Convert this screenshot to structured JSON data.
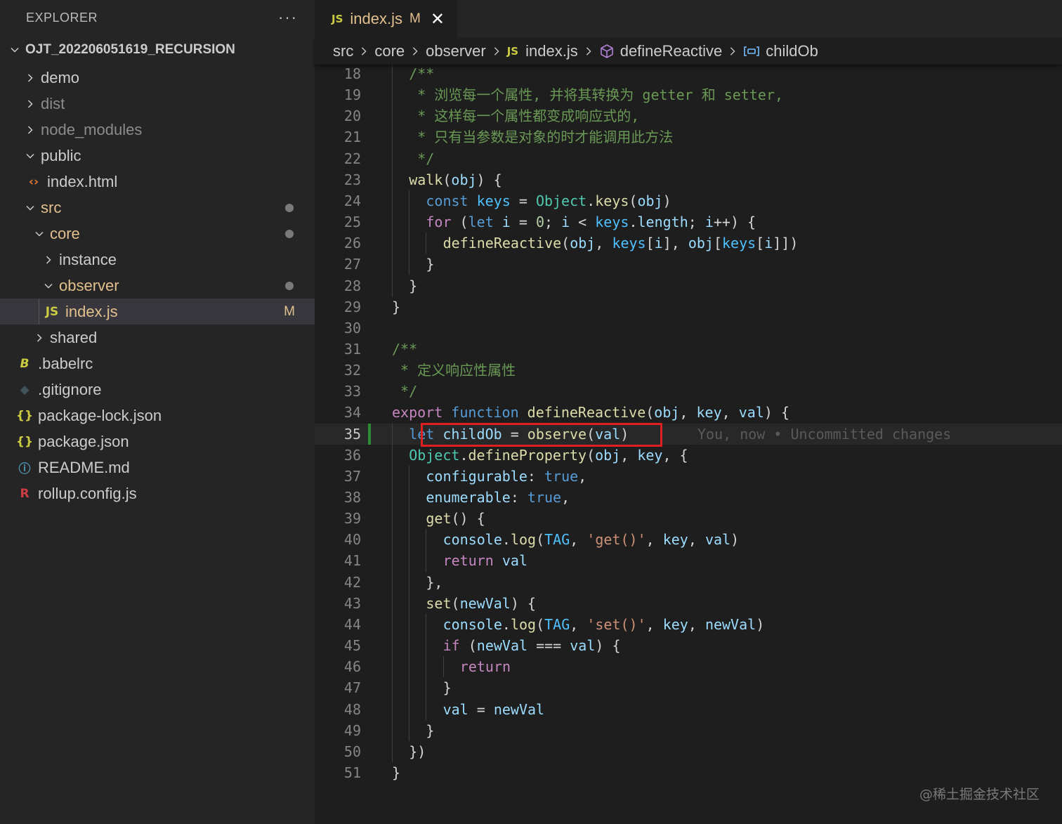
{
  "sidebar": {
    "title": "EXPLORER",
    "more": "···",
    "root": "OJT_202206051619_RECURSION",
    "items": [
      {
        "label": "demo",
        "depth": 1,
        "kind": "folder",
        "open": false
      },
      {
        "label": "dist",
        "depth": 1,
        "kind": "folder",
        "open": false,
        "dim": true
      },
      {
        "label": "node_modules",
        "depth": 1,
        "kind": "folder",
        "open": false,
        "dim": true
      },
      {
        "label": "public",
        "depth": 1,
        "kind": "folder",
        "open": true
      },
      {
        "label": "index.html",
        "depth": 2,
        "kind": "html"
      },
      {
        "label": "src",
        "depth": 1,
        "kind": "folder",
        "open": true,
        "modified": true,
        "dot": true
      },
      {
        "label": "core",
        "depth": 2,
        "kind": "folder",
        "open": true,
        "modified": true,
        "dot": true
      },
      {
        "label": "instance",
        "depth": 3,
        "kind": "folder",
        "open": false
      },
      {
        "label": "observer",
        "depth": 3,
        "kind": "folder",
        "open": true,
        "modified": true,
        "dot": true
      },
      {
        "label": "index.js",
        "depth": 4,
        "kind": "js",
        "modified": true,
        "badge": "M",
        "selected": true
      },
      {
        "label": "shared",
        "depth": 2,
        "kind": "folder",
        "open": false
      },
      {
        "label": ".babelrc",
        "depth": 1,
        "kind": "babel"
      },
      {
        "label": ".gitignore",
        "depth": 1,
        "kind": "git"
      },
      {
        "label": "package-lock.json",
        "depth": 1,
        "kind": "json"
      },
      {
        "label": "package.json",
        "depth": 1,
        "kind": "json"
      },
      {
        "label": "README.md",
        "depth": 1,
        "kind": "info"
      },
      {
        "label": "rollup.config.js",
        "depth": 1,
        "kind": "rollup"
      }
    ]
  },
  "tab": {
    "icon_text": "JS",
    "name": "index.js",
    "status": "M",
    "close": "✕"
  },
  "breadcrumbs": {
    "items": [
      "src",
      "core",
      "observer",
      "index.js",
      "defineReactive",
      "childOb"
    ],
    "js_icon": "JS"
  },
  "editor": {
    "current_line": 35,
    "lines": [
      {
        "n": "18",
        "indent": 2,
        "tokens": [
          [
            "cmt",
            "/**"
          ]
        ]
      },
      {
        "n": "19",
        "indent": 2,
        "tokens": [
          [
            "cmt",
            " * 浏览每一个属性, 并将其转换为 getter 和 setter,"
          ]
        ]
      },
      {
        "n": "20",
        "indent": 2,
        "tokens": [
          [
            "cmt",
            " * 这样每一个属性都变成响应式的,"
          ]
        ]
      },
      {
        "n": "21",
        "indent": 2,
        "tokens": [
          [
            "cmt",
            " * 只有当参数是对象的时才能调用此方法"
          ]
        ]
      },
      {
        "n": "22",
        "indent": 2,
        "tokens": [
          [
            "cmt",
            " */"
          ]
        ]
      },
      {
        "n": "23",
        "indent": 2,
        "tokens": [
          [
            "fn",
            "walk"
          ],
          [
            "pl",
            "("
          ],
          [
            "var",
            "obj"
          ],
          [
            "pl",
            ") {"
          ]
        ]
      },
      {
        "n": "24",
        "indent": 4,
        "tokens": [
          [
            "kw",
            "const "
          ],
          [
            "cst",
            "keys"
          ],
          [
            "pl",
            " = "
          ],
          [
            "cls",
            "Object"
          ],
          [
            "pl",
            "."
          ],
          [
            "fn",
            "keys"
          ],
          [
            "pl",
            "("
          ],
          [
            "var",
            "obj"
          ],
          [
            "pl",
            ")"
          ]
        ]
      },
      {
        "n": "25",
        "indent": 4,
        "tokens": [
          [
            "ctl",
            "for"
          ],
          [
            "pl",
            " ("
          ],
          [
            "kw",
            "let "
          ],
          [
            "var",
            "i"
          ],
          [
            "pl",
            " = "
          ],
          [
            "num",
            "0"
          ],
          [
            "pl",
            "; "
          ],
          [
            "var",
            "i"
          ],
          [
            "pl",
            " < "
          ],
          [
            "cst",
            "keys"
          ],
          [
            "pl",
            "."
          ],
          [
            "var",
            "length"
          ],
          [
            "pl",
            "; "
          ],
          [
            "var",
            "i"
          ],
          [
            "pl",
            "++) {"
          ]
        ]
      },
      {
        "n": "26",
        "indent": 6,
        "tokens": [
          [
            "fn",
            "defineReactive"
          ],
          [
            "pl",
            "("
          ],
          [
            "var",
            "obj"
          ],
          [
            "pl",
            ", "
          ],
          [
            "cst",
            "keys"
          ],
          [
            "pl",
            "["
          ],
          [
            "var",
            "i"
          ],
          [
            "pl",
            "], "
          ],
          [
            "var",
            "obj"
          ],
          [
            "pl",
            "["
          ],
          [
            "cst",
            "keys"
          ],
          [
            "pl",
            "["
          ],
          [
            "var",
            "i"
          ],
          [
            "pl",
            "]])"
          ]
        ]
      },
      {
        "n": "27",
        "indent": 4,
        "tokens": [
          [
            "pl",
            "}"
          ]
        ]
      },
      {
        "n": "28",
        "indent": 2,
        "tokens": [
          [
            "pl",
            "}"
          ]
        ]
      },
      {
        "n": "29",
        "indent": 0,
        "tokens": [
          [
            "pl",
            "}"
          ]
        ]
      },
      {
        "n": "30",
        "indent": 0,
        "tokens": []
      },
      {
        "n": "31",
        "indent": 0,
        "tokens": [
          [
            "cmt",
            "/**"
          ]
        ]
      },
      {
        "n": "32",
        "indent": 0,
        "tokens": [
          [
            "cmt",
            " * 定义响应性属性"
          ]
        ]
      },
      {
        "n": "33",
        "indent": 0,
        "tokens": [
          [
            "cmt",
            " */"
          ]
        ]
      },
      {
        "n": "34",
        "indent": 0,
        "tokens": [
          [
            "ctl",
            "export "
          ],
          [
            "kw",
            "function "
          ],
          [
            "fn",
            "defineReactive"
          ],
          [
            "pl",
            "("
          ],
          [
            "var",
            "obj"
          ],
          [
            "pl",
            ", "
          ],
          [
            "var",
            "key"
          ],
          [
            "pl",
            ", "
          ],
          [
            "var",
            "val"
          ],
          [
            "pl",
            ") {"
          ]
        ]
      },
      {
        "n": "35",
        "indent": 2,
        "tokens": [
          [
            "kw",
            "let "
          ],
          [
            "var",
            "childOb"
          ],
          [
            "pl",
            " = "
          ],
          [
            "fn",
            "observe"
          ],
          [
            "pl",
            "("
          ],
          [
            "var",
            "val"
          ],
          [
            "pl",
            ")"
          ]
        ],
        "blame": "You, now • Uncommitted changes"
      },
      {
        "n": "36",
        "indent": 2,
        "tokens": [
          [
            "cls",
            "Object"
          ],
          [
            "pl",
            "."
          ],
          [
            "fn",
            "defineProperty"
          ],
          [
            "pl",
            "("
          ],
          [
            "var",
            "obj"
          ],
          [
            "pl",
            ", "
          ],
          [
            "var",
            "key"
          ],
          [
            "pl",
            ", {"
          ]
        ]
      },
      {
        "n": "37",
        "indent": 4,
        "tokens": [
          [
            "var",
            "configurable"
          ],
          [
            "pl",
            ": "
          ],
          [
            "kw",
            "true"
          ],
          [
            "pl",
            ","
          ]
        ]
      },
      {
        "n": "38",
        "indent": 4,
        "tokens": [
          [
            "var",
            "enumerable"
          ],
          [
            "pl",
            ": "
          ],
          [
            "kw",
            "true"
          ],
          [
            "pl",
            ","
          ]
        ]
      },
      {
        "n": "39",
        "indent": 4,
        "tokens": [
          [
            "fn",
            "get"
          ],
          [
            "pl",
            "() {"
          ]
        ]
      },
      {
        "n": "40",
        "indent": 6,
        "tokens": [
          [
            "var",
            "console"
          ],
          [
            "pl",
            "."
          ],
          [
            "fn",
            "log"
          ],
          [
            "pl",
            "("
          ],
          [
            "cst",
            "TAG"
          ],
          [
            "pl",
            ", "
          ],
          [
            "str",
            "'get()'"
          ],
          [
            "pl",
            ", "
          ],
          [
            "var",
            "key"
          ],
          [
            "pl",
            ", "
          ],
          [
            "var",
            "val"
          ],
          [
            "pl",
            ")"
          ]
        ]
      },
      {
        "n": "41",
        "indent": 6,
        "tokens": [
          [
            "ctl",
            "return "
          ],
          [
            "var",
            "val"
          ]
        ]
      },
      {
        "n": "42",
        "indent": 4,
        "tokens": [
          [
            "pl",
            "},"
          ]
        ]
      },
      {
        "n": "43",
        "indent": 4,
        "tokens": [
          [
            "fn",
            "set"
          ],
          [
            "pl",
            "("
          ],
          [
            "var",
            "newVal"
          ],
          [
            "pl",
            ") {"
          ]
        ]
      },
      {
        "n": "44",
        "indent": 6,
        "tokens": [
          [
            "var",
            "console"
          ],
          [
            "pl",
            "."
          ],
          [
            "fn",
            "log"
          ],
          [
            "pl",
            "("
          ],
          [
            "cst",
            "TAG"
          ],
          [
            "pl",
            ", "
          ],
          [
            "str",
            "'set()'"
          ],
          [
            "pl",
            ", "
          ],
          [
            "var",
            "key"
          ],
          [
            "pl",
            ", "
          ],
          [
            "var",
            "newVal"
          ],
          [
            "pl",
            ")"
          ]
        ]
      },
      {
        "n": "45",
        "indent": 6,
        "tokens": [
          [
            "ctl",
            "if"
          ],
          [
            "pl",
            " ("
          ],
          [
            "var",
            "newVal"
          ],
          [
            "pl",
            " === "
          ],
          [
            "var",
            "val"
          ],
          [
            "pl",
            ") {"
          ]
        ]
      },
      {
        "n": "46",
        "indent": 8,
        "tokens": [
          [
            "ctl",
            "return"
          ]
        ]
      },
      {
        "n": "47",
        "indent": 6,
        "tokens": [
          [
            "pl",
            "}"
          ]
        ]
      },
      {
        "n": "48",
        "indent": 6,
        "tokens": [
          [
            "var",
            "val"
          ],
          [
            "pl",
            " = "
          ],
          [
            "var",
            "newVal"
          ]
        ]
      },
      {
        "n": "49",
        "indent": 4,
        "tokens": [
          [
            "pl",
            "}"
          ]
        ]
      },
      {
        "n": "50",
        "indent": 2,
        "tokens": [
          [
            "pl",
            "})"
          ]
        ]
      },
      {
        "n": "51",
        "indent": 0,
        "tokens": [
          [
            "pl",
            "}"
          ]
        ]
      }
    ]
  },
  "watermark": "@稀土掘金技术社区",
  "colors": {
    "modified": "#e2c08d",
    "highlight_box": "#e02020",
    "git_added_bar": "#2d8a35",
    "js_icon": "#cbcb41"
  }
}
